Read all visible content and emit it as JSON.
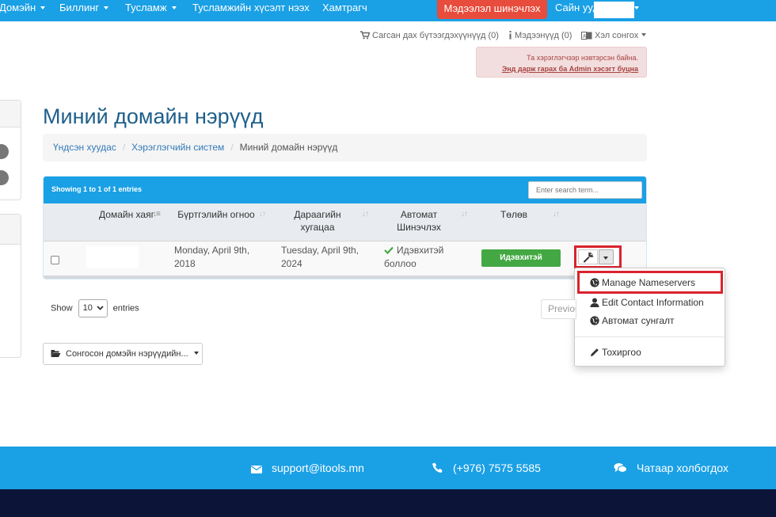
{
  "nav": {
    "items": [
      {
        "label": "Домэйн",
        "dropdown": true
      },
      {
        "label": "Биллинг",
        "dropdown": true
      },
      {
        "label": "Тусламж",
        "dropdown": true
      },
      {
        "label": "Тусламжийн хүсэлт нээх",
        "dropdown": false
      },
      {
        "label": "Хамтрагч",
        "dropdown": false
      }
    ],
    "update_info_button": "Мэдээлэл шинэчлэх",
    "greeting": "Сайн уу,"
  },
  "header": {
    "cart": "Сагсан дах бүтээгдэхүүнүүд (0)",
    "notifications": "Мэдээнүүд (0)",
    "language": "Хэл сонгох"
  },
  "admin_alert": {
    "line1": "Та хэрэглэгчээр нэвтэрсэн байна.",
    "line2": "Энд дарж гарах ба Admin хэсэгт буцна"
  },
  "page": {
    "title": "Миний домайн нэрүүд"
  },
  "breadcrumb": {
    "items": [
      "Үндсэн хуудас",
      "Хэрэглэгчийн систем",
      "Миний домайн нэрүүд"
    ]
  },
  "table": {
    "entries_info": "Showing 1 to 1 of 1 entries",
    "search_placeholder": "Enter search term...",
    "headers": {
      "domain": "Домайн хаяг",
      "reg_date": "Бүртгэлийн огноо",
      "next_due_l1": "Дараагийн",
      "next_due_l2": "хугацаа",
      "auto_renew_l1": "Автомат",
      "auto_renew_l2": "Шинэчлэх",
      "status": "Төлөв"
    },
    "rows": [
      {
        "reg_date_l1": "Monday, April 9th,",
        "reg_date_l2": "2018",
        "next_due_l1": "Tuesday, April 9th,",
        "next_due_l2": "2024",
        "auto_renew_l1": "Идэвхитэй",
        "auto_renew_l2": "боллоо",
        "status": "Идэвхитэй"
      }
    ]
  },
  "action_menu": {
    "items": [
      "Manage Nameservers",
      "Edit Contact Information",
      "Автомат сунгалт",
      "Тохиргоо"
    ]
  },
  "pagination": {
    "show": "Show",
    "page_size": "10",
    "entries": "entries",
    "previous": "Previous"
  },
  "bulk_action": {
    "label": "Сонгосон домэйн нэрүүдийн..."
  },
  "footer": {
    "email": "support@itools.mn",
    "phone": "(+976) 7575 5585",
    "chat": "Чатаар холбогдох"
  },
  "colors": {
    "primary": "#1aa0e5",
    "danger": "#e74c3c",
    "success": "#43a843",
    "highlight": "#d9232d",
    "footer_dark": "#0c1438"
  }
}
